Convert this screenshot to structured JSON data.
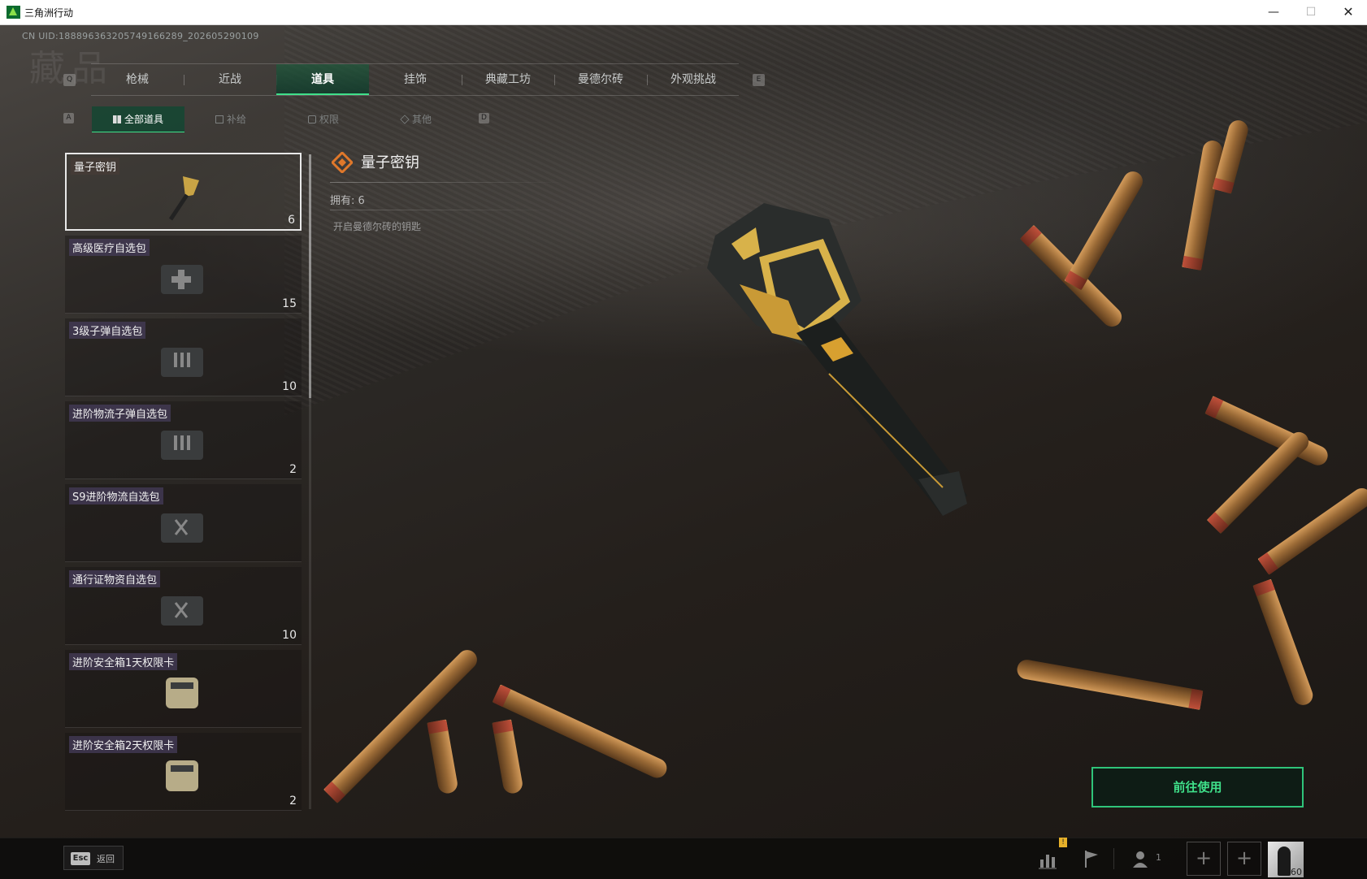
{
  "window": {
    "title": "三角洲行动",
    "minimize": "—",
    "maximize": "☐",
    "close": "✕"
  },
  "uid": "CN UID:188896363205749166289_202605290109",
  "top_tabs": {
    "left_key": "Q",
    "right_key": "E",
    "items": [
      {
        "label": "枪械"
      },
      {
        "label": "近战"
      },
      {
        "label": "道具",
        "active": true
      },
      {
        "label": "挂饰"
      },
      {
        "label": "典藏工坊"
      },
      {
        "label": "曼德尔砖"
      },
      {
        "label": "外观挑战"
      }
    ]
  },
  "sub_tabs": {
    "left_key": "A",
    "right_key": "D",
    "items": [
      {
        "label": "全部道具",
        "active": true
      },
      {
        "label": "补给"
      },
      {
        "label": "权限"
      },
      {
        "label": "其他"
      }
    ]
  },
  "items": [
    {
      "name": "量子密钥",
      "qty": "6",
      "selected": true
    },
    {
      "name": "高级医疗自选包",
      "qty": "15"
    },
    {
      "name": "3级子弹自选包",
      "qty": "10"
    },
    {
      "name": "进阶物流子弹自选包",
      "qty": "2"
    },
    {
      "name": "S9进阶物流自选包",
      "qty": ""
    },
    {
      "name": "通行证物资自选包",
      "qty": "10"
    },
    {
      "name": "进阶安全箱1天权限卡",
      "qty": ""
    },
    {
      "name": "进阶安全箱2天权限卡",
      "qty": "2"
    }
  ],
  "detail": {
    "title": "量子密钥",
    "owned": "拥有: 6",
    "description": "开启曼德尔砖的钥匙"
  },
  "actions": {
    "use": "前往使用"
  },
  "bottom": {
    "esc_key": "Esc",
    "esc_label": "返回",
    "notify_badge": "!",
    "team_count": "1",
    "avatar_level": "60"
  },
  "colors": {
    "accent": "#3fe08a",
    "tab_active_bg": "#1e5a3c",
    "item_label_bg": "#463c5a",
    "detail_icon": "#e0782a"
  }
}
